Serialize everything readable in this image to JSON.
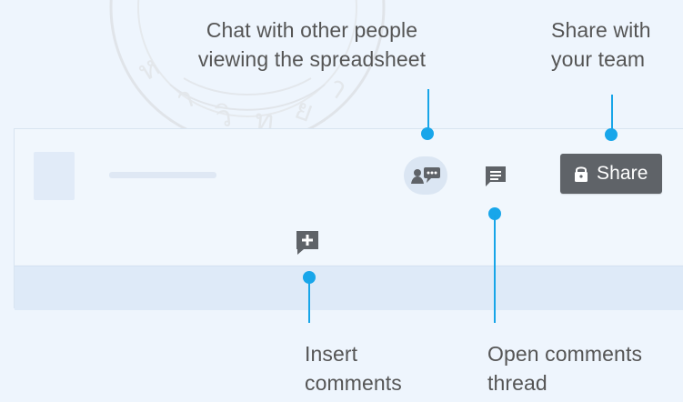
{
  "captions": {
    "chat": "Chat with other people\nviewing the spreadsheet",
    "share": "Share with\nyour team",
    "insert_comments": "Insert\ncomments",
    "open_comments_thread": "Open comments\nthread"
  },
  "toolbar": {
    "share_label": "Share"
  },
  "colors": {
    "background": "#eef5fd",
    "callout": "#18a6ea",
    "share_button": "#5f6368",
    "icon": "#5f6368",
    "chat_badge": "#dbe6f3",
    "text": "#555555",
    "watermark": "#d7d7d7"
  },
  "icons": {
    "chat": "chat-people-icon",
    "comments": "comments-icon",
    "share": "lock-icon",
    "insert": "insert-comment-icon"
  }
}
